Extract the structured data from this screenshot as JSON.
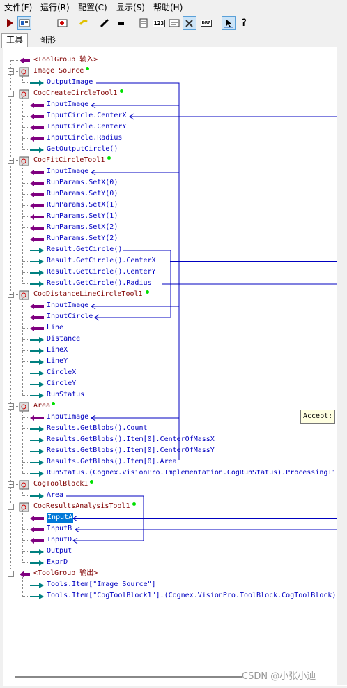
{
  "menu": {
    "items": [
      "文件(F)",
      "运行(R)",
      "配置(C)",
      "显示(S)",
      "帮助(H)"
    ]
  },
  "toolbar": {
    "buttons": [
      {
        "icon": "run-icon"
      },
      {
        "icon": "tool-grid-icon"
      },
      {
        "icon": "record-icon"
      },
      {
        "icon": "link-icon"
      },
      {
        "icon": "brush-icon"
      },
      {
        "icon": "battery-icon"
      },
      {
        "icon": "clipboard-icon"
      },
      {
        "icon": "number-123-icon",
        "text": "123"
      },
      {
        "icon": "screen-icon"
      },
      {
        "icon": "tools-icon"
      },
      {
        "icon": "debug-icon",
        "text": "DBG"
      },
      {
        "icon": "cursor-icon"
      },
      {
        "icon": "help-icon",
        "text": "?"
      }
    ]
  },
  "tabs": [
    "工具",
    "图形"
  ],
  "tree": {
    "rows": [
      {
        "kind": "group",
        "text": "<ToolGroup 输入>"
      },
      {
        "kind": "tool",
        "text": "Image Source"
      },
      {
        "kind": "out",
        "text": "OutputImage"
      },
      {
        "kind": "tool",
        "text": "CogCreateCircleTool1"
      },
      {
        "kind": "in",
        "text": "InputImage"
      },
      {
        "kind": "in",
        "text": "InputCircle.CenterX"
      },
      {
        "kind": "in",
        "text": "InputCircle.CenterY"
      },
      {
        "kind": "in",
        "text": "InputCircle.Radius"
      },
      {
        "kind": "out",
        "text": "GetOutputCircle()"
      },
      {
        "kind": "tool",
        "text": "CogFitCircleTool1"
      },
      {
        "kind": "in",
        "text": "InputImage"
      },
      {
        "kind": "in",
        "text": "RunParams.SetX(0)"
      },
      {
        "kind": "in",
        "text": "RunParams.SetY(0)"
      },
      {
        "kind": "in",
        "text": "RunParams.SetX(1)"
      },
      {
        "kind": "in",
        "text": "RunParams.SetY(1)"
      },
      {
        "kind": "in",
        "text": "RunParams.SetX(2)"
      },
      {
        "kind": "in",
        "text": "RunParams.SetY(2)"
      },
      {
        "kind": "out",
        "text": "Result.GetCircle()"
      },
      {
        "kind": "out",
        "text": "Result.GetCircle().CenterX"
      },
      {
        "kind": "out",
        "text": "Result.GetCircle().CenterY"
      },
      {
        "kind": "out",
        "text": "Result.GetCircle().Radius"
      },
      {
        "kind": "tool",
        "text": "CogDistanceLineCircleTool1"
      },
      {
        "kind": "in",
        "text": "InputImage"
      },
      {
        "kind": "in",
        "text": "InputCircle"
      },
      {
        "kind": "in",
        "text": "Line"
      },
      {
        "kind": "out",
        "text": "Distance"
      },
      {
        "kind": "out",
        "text": "LineX"
      },
      {
        "kind": "out",
        "text": "LineY"
      },
      {
        "kind": "out",
        "text": "CircleX"
      },
      {
        "kind": "out",
        "text": "CircleY"
      },
      {
        "kind": "out",
        "text": "RunStatus"
      },
      {
        "kind": "tool",
        "text": "Area"
      },
      {
        "kind": "in",
        "text": "InputImage"
      },
      {
        "kind": "out",
        "text": "Results.GetBlobs().Count"
      },
      {
        "kind": "out",
        "text": "Results.GetBlobs().Item[0].CenterOfMassX"
      },
      {
        "kind": "out",
        "text": "Results.GetBlobs().Item[0].CenterOfMassY"
      },
      {
        "kind": "out",
        "text": "Results.GetBlobs().Item[0].Area"
      },
      {
        "kind": "out",
        "text": "RunStatus.(Cognex.VisionPro.Implementation.CogRunStatus).ProcessingTi"
      },
      {
        "kind": "tool",
        "text": "CogToolBlock1"
      },
      {
        "kind": "out",
        "text": "Area"
      },
      {
        "kind": "tool",
        "text": "CogResultsAnalysisTool1"
      },
      {
        "kind": "in",
        "text": "InputA",
        "selected": true
      },
      {
        "kind": "in",
        "text": "InputB"
      },
      {
        "kind": "in",
        "text": "InputD"
      },
      {
        "kind": "out",
        "text": "Output"
      },
      {
        "kind": "out",
        "text": "ExprD"
      },
      {
        "kind": "group",
        "text": "<ToolGroup 输出>"
      },
      {
        "kind": "out",
        "text": "Tools.Item[\"Image Source\"]"
      },
      {
        "kind": "out",
        "text": "Tools.Item[\"CogToolBlock1\"].(Cognex.VisionPro.ToolBlock.CogToolBlock)"
      }
    ]
  },
  "tooltip": {
    "text": "Accept:"
  },
  "watermark": {
    "text": "CSDN @小张小迪"
  },
  "colors": {
    "in_arrow": "#800080",
    "out_arrow": "#008080",
    "link": "#0000c0",
    "selected": "#0078d7",
    "status_ok": "#00e000"
  }
}
